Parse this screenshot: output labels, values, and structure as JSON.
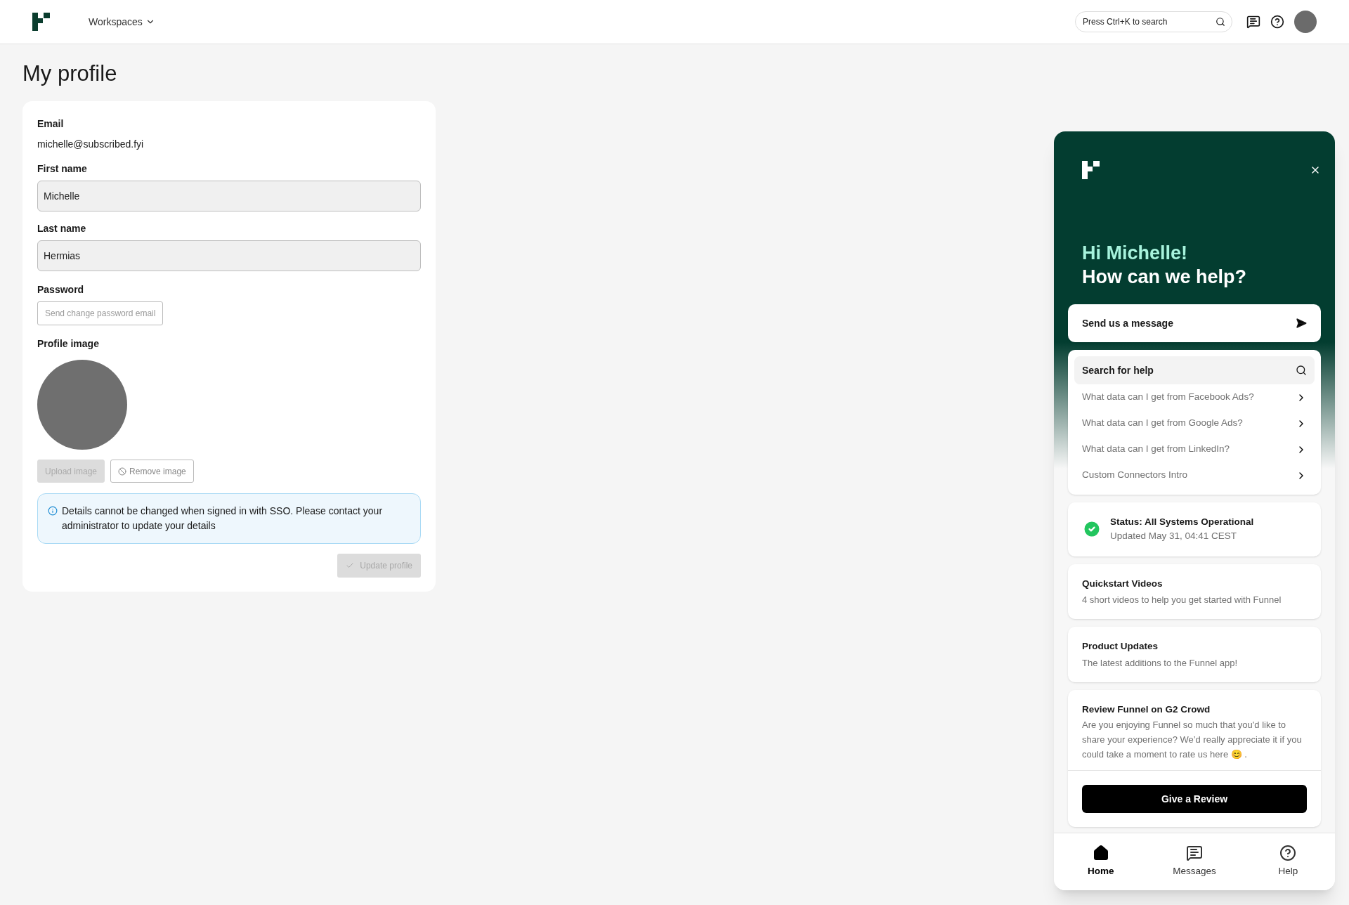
{
  "header": {
    "workspaces": "Workspaces",
    "search": {
      "placeholder": "Press Ctrl+K to search"
    }
  },
  "page": {
    "title": "My profile"
  },
  "profile": {
    "email_label": "Email",
    "email": "michelle@subscribed.fyi",
    "fields": [
      {
        "label": "First name",
        "value": "Michelle",
        "disabled": true
      },
      {
        "label": "Last name",
        "value": "Hermias",
        "disabled": true
      }
    ],
    "password_label": "Password",
    "password_button": "Send change password email",
    "image_label": "Profile image",
    "image_buttons": [
      {
        "label": "Upload image",
        "disabled": true,
        "kind": "filled"
      },
      {
        "label": "Remove image",
        "disabled": false,
        "kind": "outline"
      }
    ],
    "notice": "Details cannot be changed when signed in with SSO. Please contact your administrator to update your details",
    "submit": {
      "label": "Update profile",
      "disabled": true
    }
  },
  "help": {
    "greeting": "Hi Michelle!",
    "question": "How can we help?",
    "send_message": "Send us a message",
    "search_label": "Search for help",
    "articles": [
      "What data can I get from Facebook Ads?",
      "What data can I get from Google Ads?",
      "What data can I get from LinkedIn?",
      "Custom Connectors Intro"
    ],
    "status": {
      "title": "Status: All Systems Operational",
      "updated": "Updated May 31, 04:41 CEST"
    },
    "cards": [
      {
        "title": "Quickstart Videos",
        "text": "4 short videos to help you get started with Funnel"
      },
      {
        "title": "Product Updates",
        "text": "The latest additions to the Funnel app!"
      }
    ],
    "review": {
      "title": "Review Funnel on G2 Crowd",
      "text": "Are you enjoying Funnel so much that you'd like to share your experience? We’d really appreciate it if you could take a moment to rate us here 😊 .",
      "button": "Give a Review"
    },
    "nav": [
      {
        "label": "Home",
        "kind": "home",
        "selected": true
      },
      {
        "label": "Messages",
        "kind": "messages",
        "selected": false
      },
      {
        "label": "Help",
        "kind": "help",
        "selected": false
      }
    ]
  }
}
